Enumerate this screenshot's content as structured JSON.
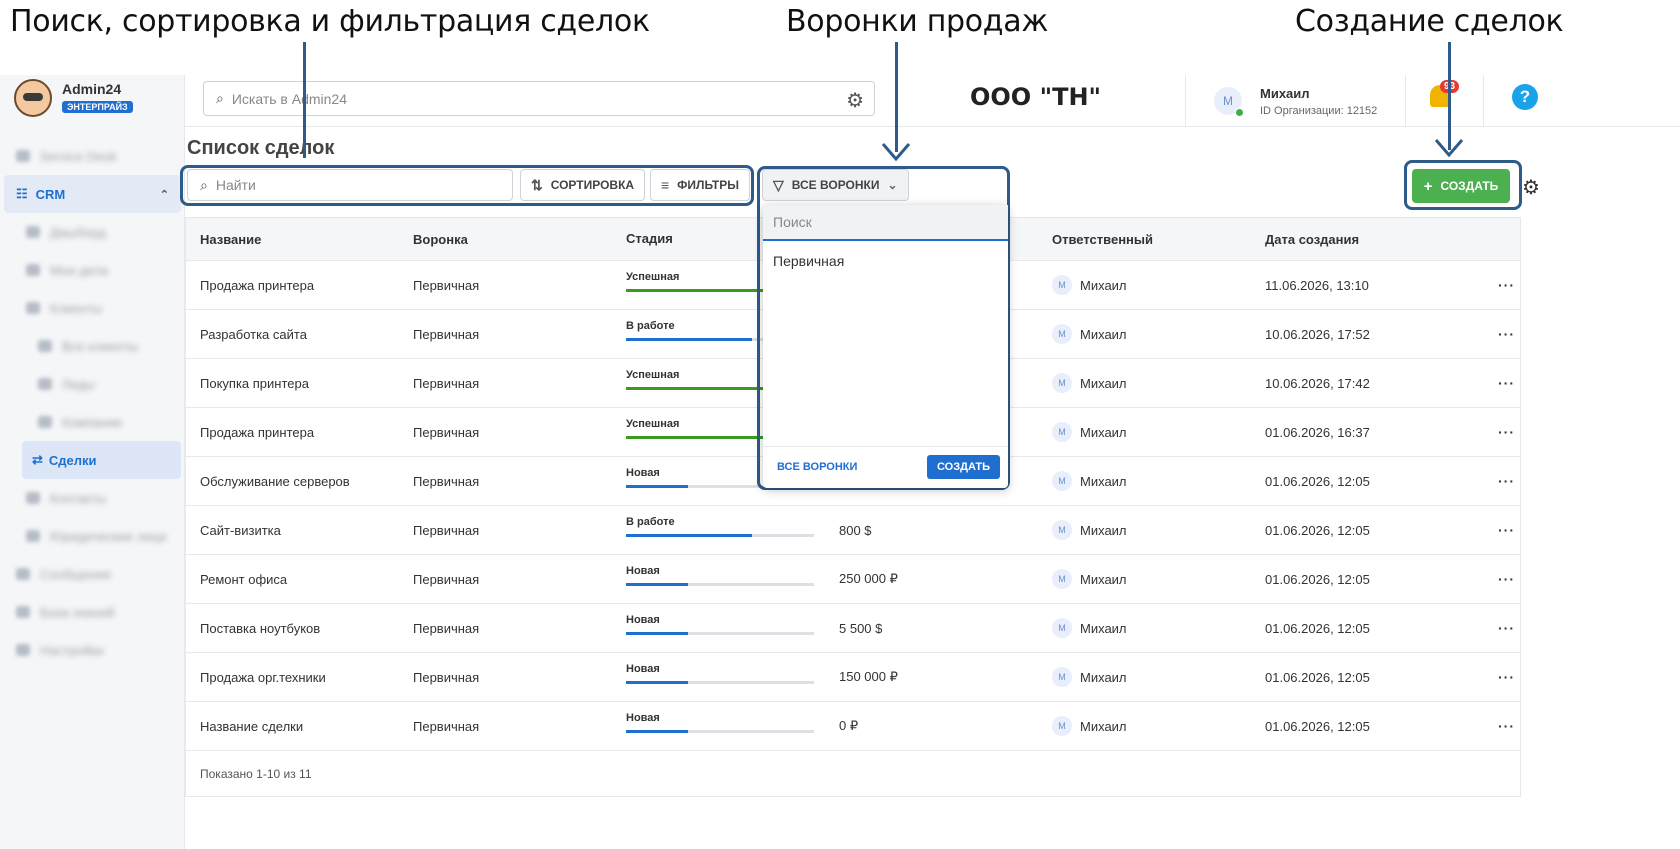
{
  "annotations": {
    "search_sort_filter": "Поиск, сортировка и фильтрация сделок",
    "funnels": "Воронки продаж",
    "create": "Создание сделок"
  },
  "app": {
    "name": "Admin24",
    "plan_badge": "ЭНТЕРПРАЙЗ"
  },
  "topbar": {
    "search_placeholder": "Искать в Admin24",
    "org_name": "ООО \"ТН\"",
    "user_initial": "М",
    "user_name": "Михаил",
    "org_id_text": "ID Организации: 12152",
    "notifications_count": "93",
    "help_label": "?"
  },
  "sidebar": {
    "crm_label": "CRM",
    "deals_label": "Сделки"
  },
  "page": {
    "title": "Список сделок",
    "search_placeholder": "Найти",
    "sort_label": "СОРТИРОВКА",
    "filters_label": "ФИЛЬТРЫ",
    "funnels_label": "ВСЕ ВОРОНКИ",
    "create_label": "СОЗДАТЬ"
  },
  "table": {
    "headers": [
      "Название",
      "Воронка",
      "Стадия",
      "Ответственный",
      "Дата создания"
    ],
    "rows": [
      {
        "name": "Продажа принтера",
        "funnel": "Первичная",
        "stage": "Успешная",
        "progress": 1.0,
        "amount": "",
        "owner": "Михаил",
        "date": "11.06.2026, 13:10"
      },
      {
        "name": "Разработка сайта",
        "funnel": "Первичная",
        "stage": "В работе",
        "progress": 0.67,
        "amount": "",
        "owner": "Михаил",
        "date": "10.06.2026, 17:52"
      },
      {
        "name": "Покупка принтера",
        "funnel": "Первичная",
        "stage": "Успешная",
        "progress": 1.0,
        "amount": "",
        "owner": "Михаил",
        "date": "10.06.2026, 17:42"
      },
      {
        "name": "Продажа принтера",
        "funnel": "Первичная",
        "stage": "Успешная",
        "progress": 1.0,
        "amount": "",
        "owner": "Михаил",
        "date": "01.06.2026, 16:37"
      },
      {
        "name": "Обслуживание серверов",
        "funnel": "Первичная",
        "stage": "Новая",
        "progress": 0.33,
        "amount": "",
        "owner": "Михаил",
        "date": "01.06.2026, 12:05"
      },
      {
        "name": "Сайт-визитка",
        "funnel": "Первичная",
        "stage": "В работе",
        "progress": 0.67,
        "amount": "800 $",
        "owner": "Михаил",
        "date": "01.06.2026, 12:05"
      },
      {
        "name": "Ремонт офиса",
        "funnel": "Первичная",
        "stage": "Новая",
        "progress": 0.33,
        "amount": "250 000 ₽",
        "owner": "Михаил",
        "date": "01.06.2026, 12:05"
      },
      {
        "name": "Поставка ноутбуков",
        "funnel": "Первичная",
        "stage": "Новая",
        "progress": 0.33,
        "amount": "5 500 $",
        "owner": "Михаил",
        "date": "01.06.2026, 12:05"
      },
      {
        "name": "Продажа орг.техники",
        "funnel": "Первичная",
        "stage": "Новая",
        "progress": 0.33,
        "amount": "150 000 ₽",
        "owner": "Михаил",
        "date": "01.06.2026, 12:05"
      },
      {
        "name": "Название сделки",
        "funnel": "Первичная",
        "stage": "Новая",
        "progress": 0.33,
        "amount": "0 ₽",
        "owner": "Михаил",
        "date": "01.06.2026, 12:05"
      }
    ],
    "footer": "Показано 1-10 из 11",
    "more_label": "···"
  },
  "dropdown": {
    "search_placeholder": "Поиск",
    "items": [
      "Первичная"
    ],
    "all_label": "ВСЕ ВОРОНКИ",
    "create_label": "СОЗДАТЬ"
  },
  "colors": {
    "accent": "#1f6fd1",
    "success": "#4caf50",
    "success_bar": "#3a9a1e",
    "highlight": "#2d5b8a"
  }
}
